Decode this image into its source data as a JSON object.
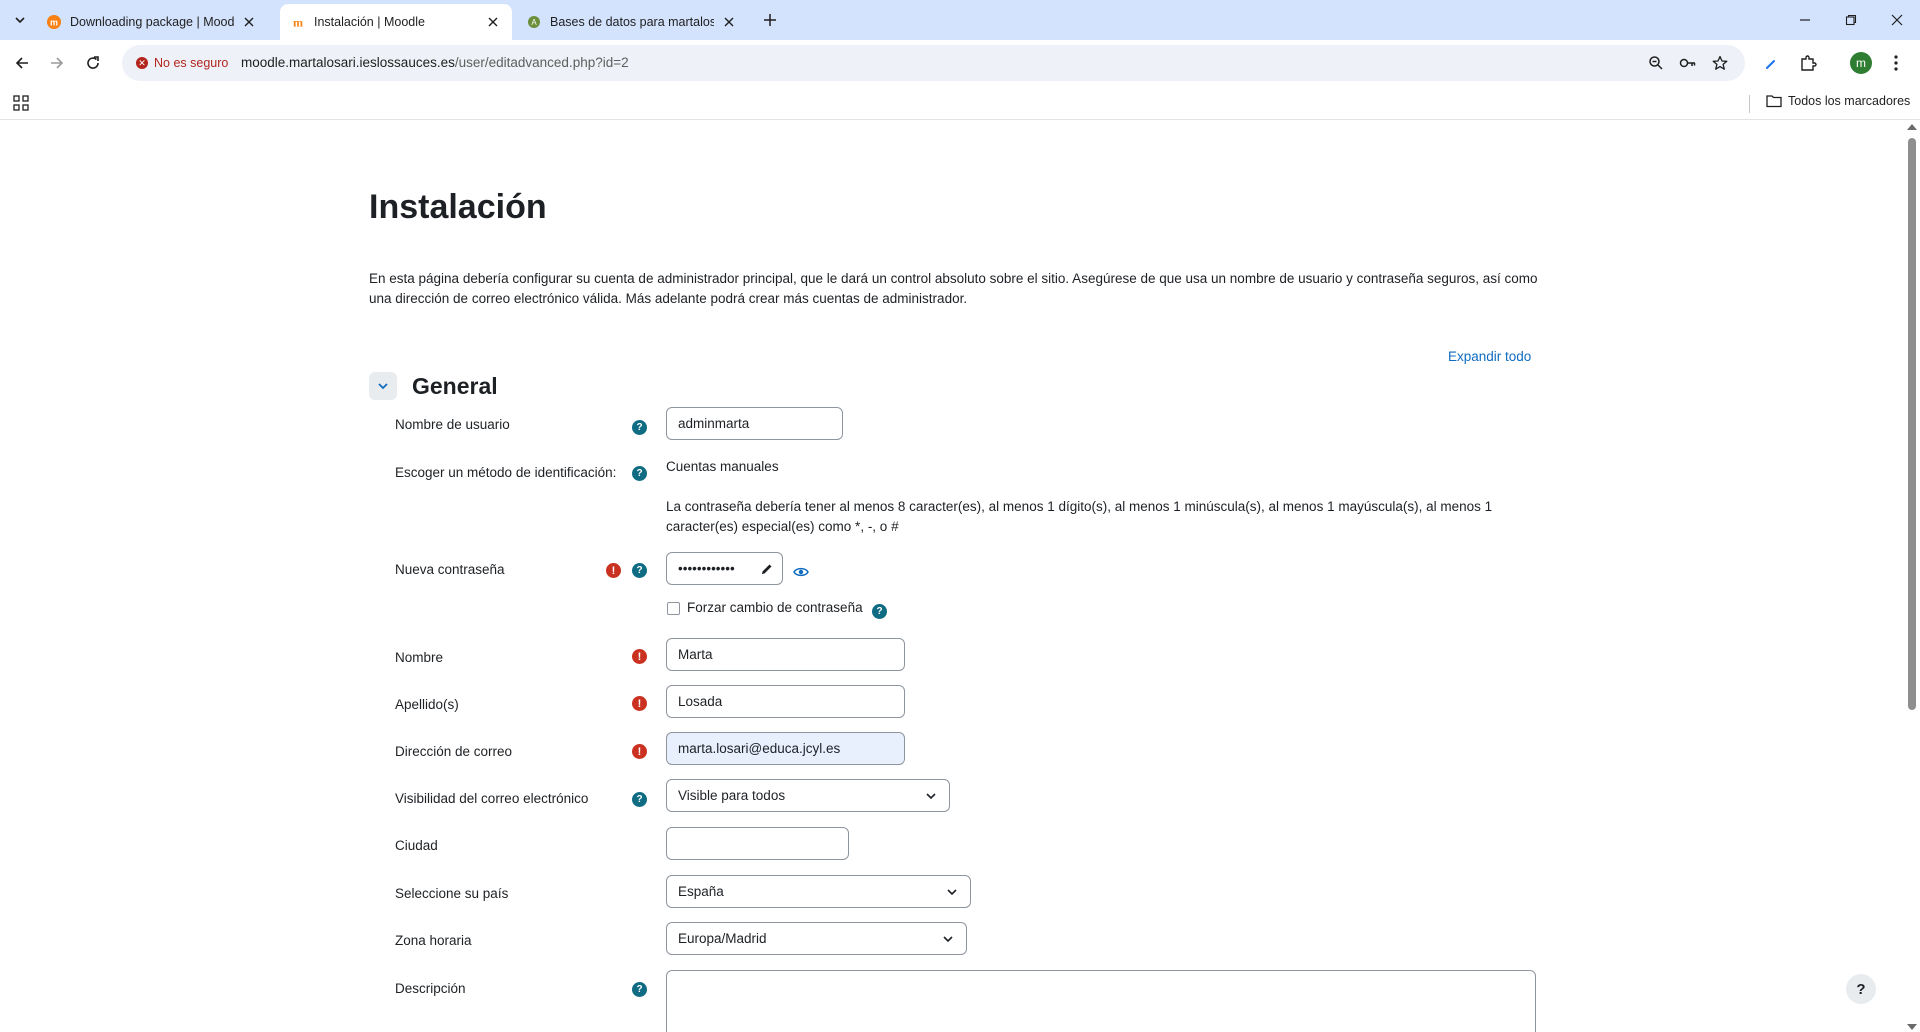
{
  "browser": {
    "tabs": [
      {
        "title": "Downloading package | Moodle",
        "active": false
      },
      {
        "title": "Instalación | Moodle",
        "active": true
      },
      {
        "title": "Bases de datos para martalosari",
        "active": false
      }
    ],
    "security_label": "No es seguro",
    "url_host": "moodle.martalosari.ieslossauces.es",
    "url_path": "/user/editadvanced.php?id=2",
    "profile_initial": "m",
    "bookmarks_label": "Todos los marcadores"
  },
  "page": {
    "title": "Instalación",
    "intro": "En esta página debería configurar su cuenta de administrador principal, que le dará un control absoluto sobre el sitio. Asegúrese de que usa un nombre de usuario y contraseña seguros, así como una dirección de correo electrónico válida. Más adelante podrá crear más cuentas de administrador.",
    "expand_all": "Expandir todo",
    "section_title": "General",
    "help_fab": "?"
  },
  "form": {
    "username": {
      "label": "Nombre de usuario",
      "value": "adminmarta"
    },
    "auth": {
      "label": "Escoger un método de identificación:",
      "value": "Cuentas manuales"
    },
    "password_note": "La contraseña debería tener al menos 8 caracter(es), al menos 1 dígito(s), al menos 1 minúscula(s), al menos 1 mayúscula(s), al menos 1 caracter(es) especial(es) como *, -, o #",
    "new_password": {
      "label": "Nueva contraseña",
      "value": "••••••••••••"
    },
    "force_change": {
      "label": "Forzar cambio de contraseña",
      "checked": false
    },
    "firstname": {
      "label": "Nombre",
      "value": "Marta"
    },
    "lastname": {
      "label": "Apellido(s)",
      "value": "Losada"
    },
    "email": {
      "label": "Dirección de correo",
      "value": "marta.losari@educa.jcyl.es"
    },
    "email_visibility": {
      "label": "Visibilidad del correo electrónico",
      "value": "Visible para todos"
    },
    "city": {
      "label": "Ciudad",
      "value": ""
    },
    "country": {
      "label": "Seleccione su país",
      "value": "España"
    },
    "timezone": {
      "label": "Zona horaria",
      "value": "Europa/Madrid"
    },
    "description": {
      "label": "Descripción",
      "value": ""
    }
  },
  "colors": {
    "link": "#0f6cbf",
    "required": "#ca3120",
    "help": "#0f6c83",
    "tabbar": "#d3e3fd"
  }
}
